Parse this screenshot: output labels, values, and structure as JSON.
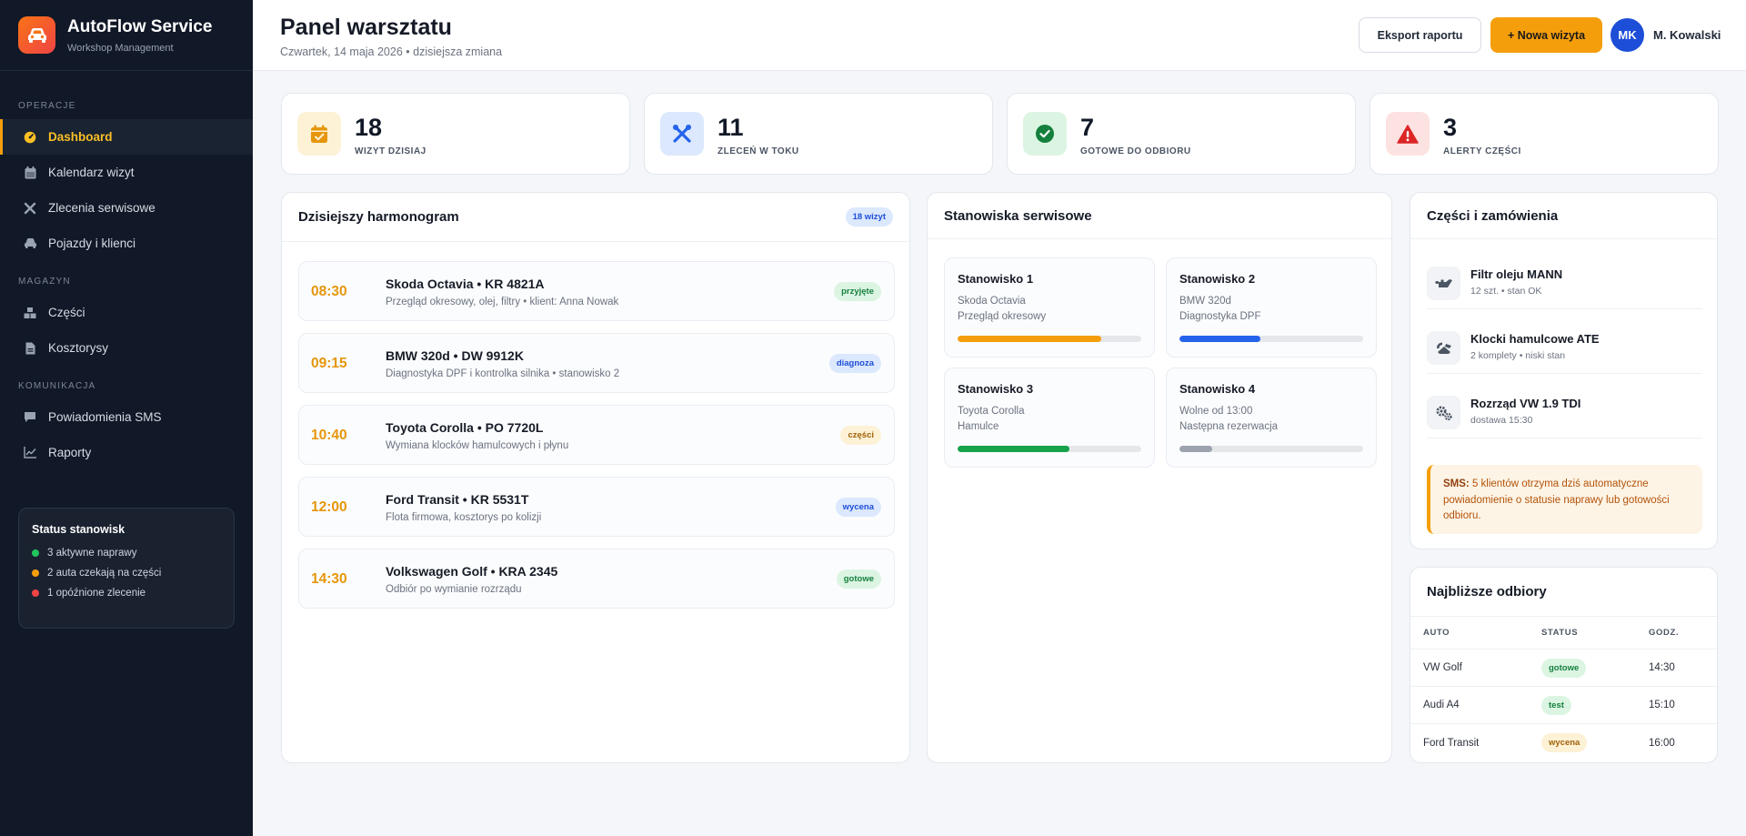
{
  "app": {
    "name": "AutoFlow Service",
    "subtitle": "Workshop Management"
  },
  "sidebar": {
    "sections": {
      "operations": "OPERACJE",
      "warehouse": "MAGAZYN",
      "communication": "KOMUNIKACJA"
    },
    "items": [
      {
        "label": "Dashboard",
        "icon": "dashboard-icon"
      },
      {
        "label": "Kalendarz wizyt",
        "icon": "calendar-icon"
      },
      {
        "label": "Zlecenia serwisowe",
        "icon": "tools-icon"
      },
      {
        "label": "Pojazdy i klienci",
        "icon": "car-icon"
      },
      {
        "label": "Części",
        "icon": "cubes-icon"
      },
      {
        "label": "Kosztorysy",
        "icon": "document-icon"
      },
      {
        "label": "Powiadomienia SMS",
        "icon": "message-icon"
      },
      {
        "label": "Raporty",
        "icon": "chart-icon"
      }
    ],
    "status": {
      "title": "Status stanowisk",
      "rows": [
        {
          "text": "3 aktywne naprawy",
          "color": "#22c55e"
        },
        {
          "text": "2 auta czekają na części",
          "color": "#f59e0b"
        },
        {
          "text": "1 opóźnione zlecenie",
          "color": "#ef4444"
        }
      ]
    }
  },
  "header": {
    "title": "Panel warsztatu",
    "subtitle": "Czwartek, 14 maja 2026 • dzisiejsza zmiana",
    "export_label": "Eksport raportu",
    "new_visit_label": "+ Nowa wizyta",
    "user_initials": "MK",
    "user_name": "M. Kowalski"
  },
  "kpis": [
    {
      "value": "18",
      "label": "WIZYT DZISIAJ",
      "icon": "calendar-check-icon",
      "bg": "#fdf1d6",
      "color": "#e6960c"
    },
    {
      "value": "11",
      "label": "ZLECEŃ W TOKU",
      "icon": "tools-icon",
      "bg": "#dbe8fd",
      "color": "#2563eb"
    },
    {
      "value": "7",
      "label": "GOTOWE DO ODBIORU",
      "icon": "check-circle-icon",
      "bg": "#dcf5e3",
      "color": "#15803d"
    },
    {
      "value": "3",
      "label": "ALERTY CZĘŚCI",
      "icon": "warning-icon",
      "bg": "#fde2e2",
      "color": "#dc2626"
    }
  ],
  "schedule": {
    "title": "Dzisiejszy harmonogram",
    "badge": "18 wizyt",
    "items": [
      {
        "time": "08:30",
        "title": "Skoda Octavia • KR 4821A",
        "desc": "Przegląd okresowy, olej, filtry • klient: Anna Nowak",
        "status": "przyjęte"
      },
      {
        "time": "09:15",
        "title": "BMW 320d • DW 9912K",
        "desc": "Diagnostyka DPF i kontrolka silnika • stanowisko 2",
        "status": "diagnoza"
      },
      {
        "time": "10:40",
        "title": "Toyota Corolla • PO 7720L",
        "desc": "Wymiana klocków hamulcowych i płynu",
        "status": "części"
      },
      {
        "time": "12:00",
        "title": "Ford Transit • KR 5531T",
        "desc": "Flota firmowa, kosztorys po kolizji",
        "status": "wycena"
      },
      {
        "time": "14:30",
        "title": "Volkswagen Golf • KRA 2345",
        "desc": "Odbiór po wymianie rozrządu",
        "status": "gotowe"
      }
    ]
  },
  "stations": {
    "title": "Stanowiska serwisowe",
    "items": [
      {
        "name": "Stanowisko 1",
        "line1": "Skoda Octavia",
        "line2": "Przegląd okresowy",
        "progress": 0.78,
        "color": "#f59e0b"
      },
      {
        "name": "Stanowisko 2",
        "line1": "BMW 320d",
        "line2": "Diagnostyka DPF",
        "progress": 0.44,
        "color": "#2563eb"
      },
      {
        "name": "Stanowisko 3",
        "line1": "Toyota Corolla",
        "line2": "Hamulce",
        "progress": 0.61,
        "color": "#16a34a"
      },
      {
        "name": "Stanowisko 4",
        "line1": "Wolne od 13:00",
        "line2": "Następna rezerwacja",
        "progress": 0.18,
        "color": "#9ca3af"
      }
    ]
  },
  "parts": {
    "title": "Części i zamówienia",
    "items": [
      {
        "name": "Filtr oleju MANN",
        "info": "12 szt. • stan OK",
        "icon": "oil-can-icon"
      },
      {
        "name": "Klocki hamulcowe ATE",
        "info": "2 komplety • niski stan",
        "icon": "brake-icon"
      },
      {
        "name": "Rozrząd VW 1.9 TDI",
        "info": "dostawa 15:30",
        "icon": "gears-icon"
      }
    ],
    "sms_label": "SMS:",
    "sms_text": " 5 klientów otrzyma dziś automatyczne powiadomienie o statusie naprawy lub gotowości odbioru."
  },
  "pickups": {
    "title": "Najbliższe odbiory",
    "columns": [
      "AUTO",
      "STATUS",
      "GODZ."
    ],
    "rows": [
      {
        "car": "VW Golf",
        "status": "gotowe",
        "time": "14:30"
      },
      {
        "car": "Audi A4",
        "status": "test",
        "time": "15:10"
      },
      {
        "car": "Ford Transit",
        "status": "wycena",
        "time": "16:00"
      }
    ]
  },
  "status_colors": {
    "przyjęte": {
      "bg": "#dcf5e3",
      "fg": "#15803d"
    },
    "diagnoza": {
      "bg": "#dbe8fd",
      "fg": "#1d4ed8"
    },
    "części": {
      "bg": "#fdf1d6",
      "fg": "#a16207"
    },
    "wycena": {
      "bg": "#dbe8fd",
      "fg": "#1d4ed8"
    },
    "gotowe": {
      "bg": "#dcf5e3",
      "fg": "#15803d"
    },
    "test": {
      "bg": "#dcf5e3",
      "fg": "#15803d"
    },
    "wycena_pickup": {
      "bg": "#fdf1d6",
      "fg": "#a16207"
    },
    "badge": {
      "bg": "#dbe8fd",
      "fg": "#1d4ed8"
    }
  }
}
